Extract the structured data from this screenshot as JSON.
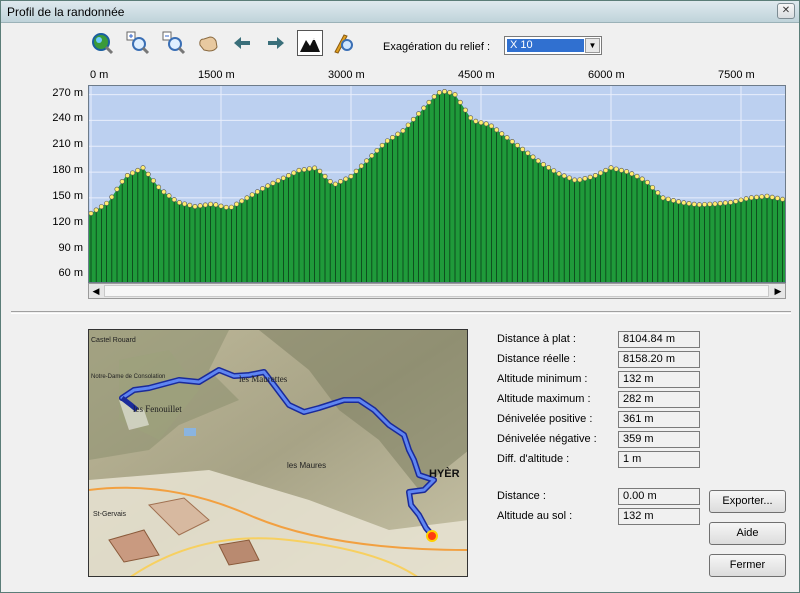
{
  "window": {
    "title": "Profil de la randonnée"
  },
  "toolbar": {
    "buttons": [
      "globe-search-icon",
      "zoom-in-icon",
      "zoom-out-icon",
      "hand-pan-icon",
      "arrow-left-icon",
      "arrow-right-icon",
      "terrain-view-icon",
      "profile-tool-icon"
    ],
    "exaggeration_label": "Exagération du relief :",
    "exaggeration_value": "X 10"
  },
  "chart_data": {
    "type": "area",
    "x_ticks": [
      "0 m",
      "1500 m",
      "3000 m",
      "4500 m",
      "6000 m",
      "7500 m"
    ],
    "y_ticks": [
      "270 m",
      "240 m",
      "210 m",
      "180 m",
      "150 m",
      "120 m",
      "90 m",
      "60 m"
    ],
    "xlim": [
      0,
      8104.84
    ],
    "ylim": [
      50,
      280
    ],
    "series": [
      {
        "x": [
          0,
          200,
          400,
          600,
          800,
          1000,
          1200,
          1400,
          1600,
          1800,
          2000,
          2200,
          2400,
          2600,
          2800,
          3000,
          3200,
          3400,
          3600,
          3800,
          4000,
          4100,
          4200,
          4300,
          4400,
          4600,
          4800,
          5000,
          5200,
          5400,
          5600,
          5800,
          6000,
          6200,
          6400,
          6600,
          6800,
          7000,
          7200,
          7400,
          7600,
          7800,
          8000,
          8104.84
        ],
        "y": [
          132,
          145,
          175,
          185,
          160,
          145,
          140,
          143,
          138,
          150,
          162,
          172,
          182,
          185,
          165,
          175,
          195,
          215,
          228,
          250,
          272,
          274,
          270,
          255,
          240,
          235,
          220,
          205,
          190,
          178,
          170,
          175,
          185,
          180,
          170,
          150,
          145,
          142,
          143,
          145,
          150,
          152,
          148,
          140
        ]
      }
    ],
    "grid": true,
    "fill_color": "#1f9a3a",
    "background_color": "#bcd0f0"
  },
  "stats": [
    {
      "label": "Distance à plat :",
      "value": "8104.84 m"
    },
    {
      "label": "Distance réelle :",
      "value": "8158.20 m"
    },
    {
      "label": "Altitude minimum :",
      "value": "132 m"
    },
    {
      "label": "Altitude maximum :",
      "value": "282 m"
    },
    {
      "label": "Dénivelée positive :",
      "value": "361 m"
    },
    {
      "label": "Dénivelée négative :",
      "value": "359 m"
    },
    {
      "label": "Diff. d'altitude :",
      "value": "1 m"
    }
  ],
  "cursor": [
    {
      "label": "Distance :",
      "value": "0.00 m"
    },
    {
      "label": "Altitude au sol :",
      "value": "132 m"
    }
  ],
  "buttons": {
    "export": "Exporter...",
    "help": "Aide",
    "close": "Fermer"
  },
  "map": {
    "labels": [
      "Castel Rouard",
      "Notre-Dame de Consolation",
      "les Fenouillet",
      "les Maurettes",
      "les Maures",
      "HYÈR",
      "St-Gervais"
    ],
    "track_color": "#3a5ce0"
  }
}
